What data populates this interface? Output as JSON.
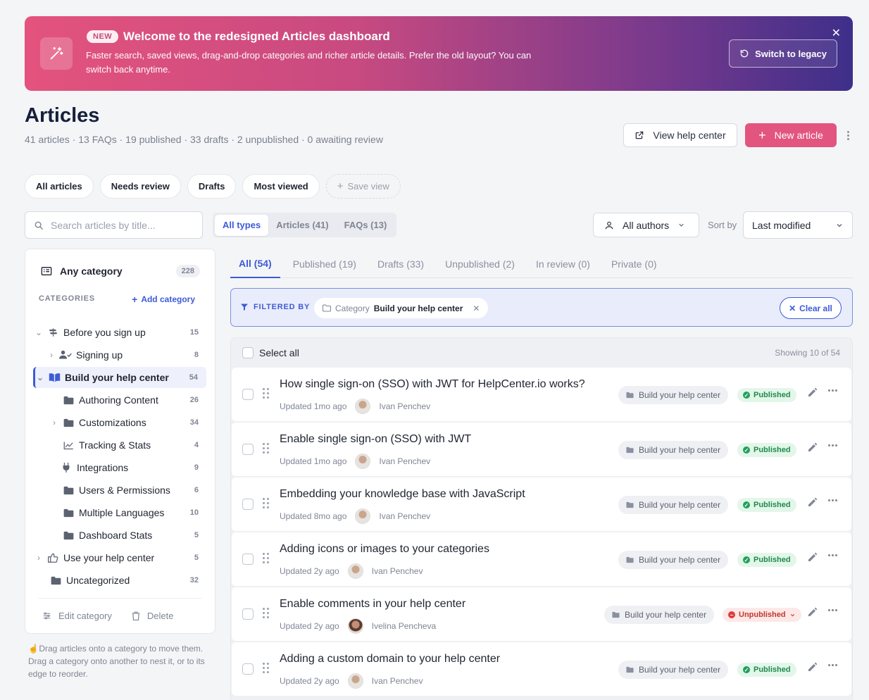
{
  "banner": {
    "badge": "NEW",
    "title": "Welcome to the redesigned Articles dashboard",
    "description": "Faster search, saved views, drag-and-drop categories and richer article details. Prefer the old layout? You can switch back anytime.",
    "legacy_label": "Switch to legacy",
    "close_glyph": "✕"
  },
  "header": {
    "title": "Articles",
    "stats": "41 articles · 13 FAQs · 19 published · 33 drafts · 2 unpublished · 0 awaiting review",
    "view_help_center": "View help center",
    "new_article": "New article"
  },
  "views": {
    "items": [
      "All articles",
      "Needs review",
      "Drafts",
      "Most viewed"
    ],
    "save_label": "Save view"
  },
  "search": {
    "placeholder": "Search articles by title..."
  },
  "types": {
    "all": "All types",
    "articles": "Articles (41)",
    "faqs": "FAQs (13)"
  },
  "authors": {
    "label": "All authors"
  },
  "sort": {
    "label": "Sort by",
    "value": "Last modified"
  },
  "sidebar": {
    "any_category": "Any category",
    "any_count": "228",
    "categories_heading": "CATEGORIES",
    "add_category": "Add category",
    "items": [
      {
        "label": "Before you sign up",
        "count": "15"
      },
      {
        "label": "Signing up",
        "count": "8"
      },
      {
        "label": "Build your help center",
        "count": "54"
      },
      {
        "label": "Authoring Content",
        "count": "26"
      },
      {
        "label": "Customizations",
        "count": "34"
      },
      {
        "label": "Tracking & Stats",
        "count": "4"
      },
      {
        "label": "Integrations",
        "count": "9"
      },
      {
        "label": "Users & Permissions",
        "count": "6"
      },
      {
        "label": "Multiple Languages",
        "count": "10"
      },
      {
        "label": "Dashboard Stats",
        "count": "5"
      },
      {
        "label": "Use your help center",
        "count": "5"
      },
      {
        "label": "Uncategorized",
        "count": "32"
      }
    ],
    "edit_category": "Edit category",
    "delete": "Delete",
    "hint": "Drag articles onto a category to move them. Drag a category onto another to nest it, or to its edge to reorder."
  },
  "tabs": [
    "All (54)",
    "Published (19)",
    "Drafts (33)",
    "Unpublished (2)",
    "In review (0)",
    "Private (0)"
  ],
  "filter": {
    "label": "FILTERED BY",
    "chip_key": "Category",
    "chip_value": "Build your help center",
    "clear_all": "Clear all"
  },
  "list": {
    "select_all": "Select all",
    "showing": "Showing 10 of 54",
    "rows": [
      {
        "title": "How single sign-on (SSO) with JWT for HelpCenter.io works?",
        "updated": "Updated 1mo ago",
        "author": "Ivan Penchev",
        "category": "Build your help center",
        "status": "Published"
      },
      {
        "title": "Enable single sign-on (SSO) with JWT",
        "updated": "Updated 1mo ago",
        "author": "Ivan Penchev",
        "category": "Build your help center",
        "status": "Published"
      },
      {
        "title": "Embedding your knowledge base with JavaScript",
        "updated": "Updated 8mo ago",
        "author": "Ivan Penchev",
        "category": "Build your help center",
        "status": "Published"
      },
      {
        "title": "Adding icons or images to your categories",
        "updated": "Updated 2y ago",
        "author": "Ivan Penchev",
        "category": "Build your help center",
        "status": "Published"
      },
      {
        "title": "Enable comments in your help center",
        "updated": "Updated 2y ago",
        "author": "Ivelina Pencheva",
        "category": "Build your help center",
        "status": "Unpublished"
      },
      {
        "title": "Adding a custom domain to your help center",
        "updated": "Updated 2y ago",
        "author": "Ivan Penchev",
        "category": "Build your help center",
        "status": "Published"
      }
    ]
  },
  "colors": {
    "accent": "#3d5bd8",
    "brand": "#e2557f",
    "published": "#1e8a4a",
    "unpublished": "#c0392b"
  }
}
